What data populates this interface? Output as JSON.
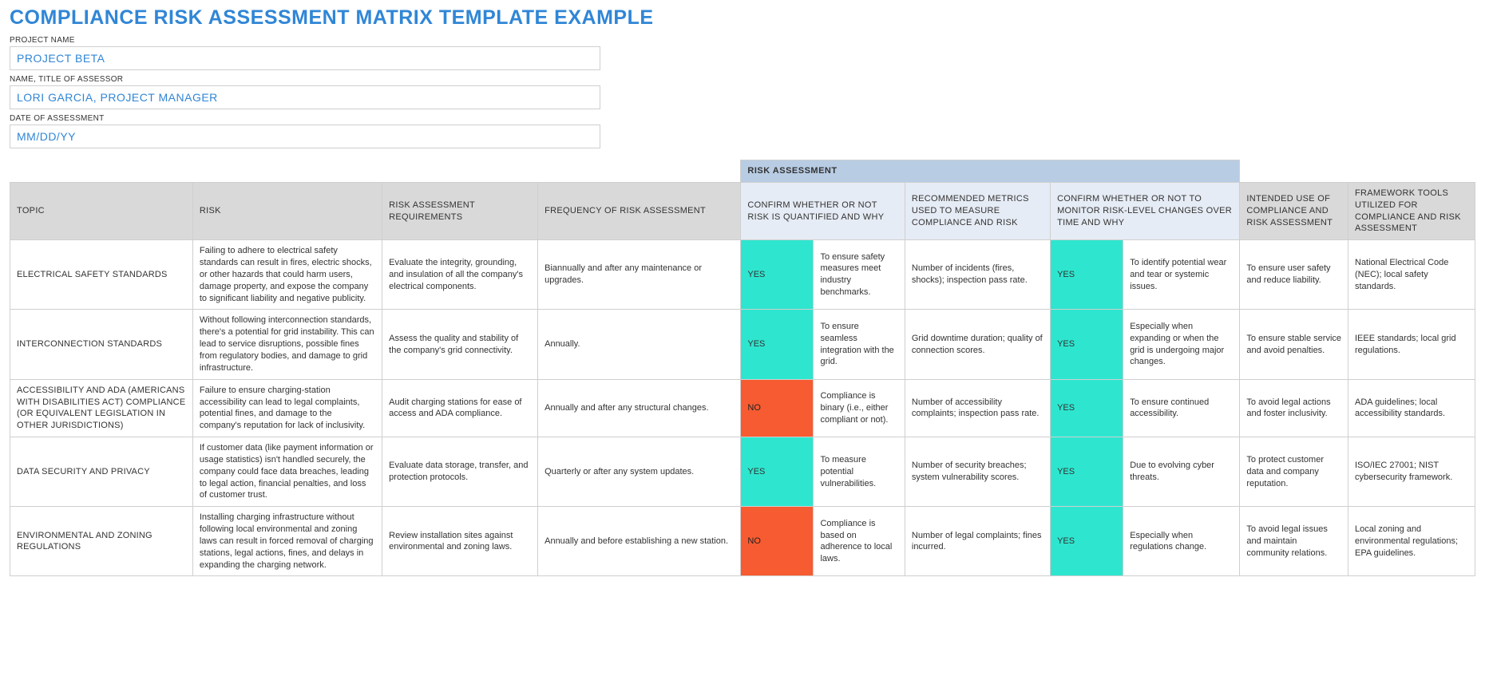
{
  "title": "COMPLIANCE RISK ASSESSMENT MATRIX TEMPLATE EXAMPLE",
  "fields": {
    "project_name": {
      "label": "PROJECT NAME",
      "value": "PROJECT BETA"
    },
    "assessor": {
      "label": "NAME, TITLE OF ASSESSOR",
      "value": "LORI GARCIA, PROJECT MANAGER"
    },
    "date": {
      "label": "DATE OF ASSESSMENT",
      "value": "MM/DD/YY"
    }
  },
  "headers": {
    "group": "RISK ASSESSMENT",
    "cols": [
      "TOPIC",
      "RISK",
      "RISK ASSESSMENT REQUIREMENTS",
      "FREQUENCY OF RISK ASSESSMENT",
      "CONFIRM WHETHER OR NOT RISK IS QUANTIFIED AND WHY",
      "RECOMMENDED METRICS USED TO MEASURE COMPLIANCE AND RISK",
      "CONFIRM WHETHER OR NOT TO MONITOR RISK-LEVEL CHANGES OVER TIME AND WHY",
      "INTENDED USE OF COMPLIANCE AND RISK ASSESSMENT",
      "FRAMEWORK TOOLS UTILIZED FOR COMPLIANCE AND RISK ASSESSMENT"
    ]
  },
  "rows": [
    {
      "topic": "ELECTRICAL SAFETY STANDARDS",
      "risk": "Failing to adhere to electrical safety standards can result in fires, electric shocks, or other hazards that could harm users, damage property, and expose the company to significant liability and negative publicity.",
      "requirements": "Evaluate the integrity, grounding, and insulation of all the company's electrical components.",
      "frequency": "Biannually and after any maintenance or upgrades.",
      "quant_flag": "YES",
      "quant_why": "To ensure safety measures meet industry benchmarks.",
      "metrics": "Number of incidents (fires, shocks); inspection pass rate.",
      "monitor_flag": "YES",
      "monitor_why": "To identify potential wear and tear or systemic issues.",
      "intended": "To ensure user safety and reduce liability.",
      "tools": "National Electrical Code (NEC); local safety standards."
    },
    {
      "topic": "INTERCONNECTION STANDARDS",
      "risk": "Without following interconnection standards, there's a potential for grid instability. This can lead to service disruptions, possible fines from regulatory bodies, and damage to grid infrastructure.",
      "requirements": "Assess the quality and stability of the company's grid connectivity.",
      "frequency": "Annually.",
      "quant_flag": "YES",
      "quant_why": "To ensure seamless integration with the grid.",
      "metrics": "Grid downtime duration; quality of connection scores.",
      "monitor_flag": "YES",
      "monitor_why": "Especially when expanding or when the grid is undergoing major changes.",
      "intended": "To ensure stable service and avoid penalties.",
      "tools": "IEEE standards; local grid regulations."
    },
    {
      "topic": "ACCESSIBILITY AND ADA (AMERICANS WITH DISABILITIES ACT) COMPLIANCE (OR EQUIVALENT LEGISLATION IN OTHER JURISDICTIONS)",
      "risk": "Failure to ensure charging-station accessibility can lead to legal complaints, potential fines, and damage to the company's reputation for lack of inclusivity.",
      "requirements": "Audit charging stations for ease of access and ADA compliance.",
      "frequency": "Annually and after any structural changes.",
      "quant_flag": "NO",
      "quant_why": "Compliance is binary (i.e., either compliant or not).",
      "metrics": "Number of accessibility complaints; inspection pass rate.",
      "monitor_flag": "YES",
      "monitor_why": "To ensure continued accessibility.",
      "intended": "To avoid legal actions and foster inclusivity.",
      "tools": "ADA guidelines; local accessibility standards."
    },
    {
      "topic": "DATA SECURITY AND PRIVACY",
      "risk": "If customer data (like payment information or usage statistics) isn't handled securely, the company could face data breaches, leading to legal action, financial penalties, and loss of customer trust.",
      "requirements": "Evaluate data storage, transfer, and protection protocols.",
      "frequency": "Quarterly or after any system updates.",
      "quant_flag": "YES",
      "quant_why": "To measure potential vulnerabilities.",
      "metrics": "Number of security breaches; system vulnerability scores.",
      "monitor_flag": "YES",
      "monitor_why": "Due to evolving cyber threats.",
      "intended": "To protect customer data and company reputation.",
      "tools": "ISO/IEC 27001; NIST cybersecurity framework."
    },
    {
      "topic": "ENVIRONMENTAL AND ZONING REGULATIONS",
      "risk": "Installing charging infrastructure without following local environmental and zoning laws can result in forced removal of charging stations, legal actions, fines, and delays in expanding the charging network.",
      "requirements": "Review installation sites against environmental and zoning laws.",
      "frequency": "Annually and before establishing a new station.",
      "quant_flag": "NO",
      "quant_why": "Compliance is based on adherence to local laws.",
      "metrics": "Number of legal complaints; fines incurred.",
      "monitor_flag": "YES",
      "monitor_why": "Especially when regulations change.",
      "intended": "To avoid legal issues and maintain community relations.",
      "tools": "Local zoning and environmental regulations; EPA guidelines."
    }
  ]
}
